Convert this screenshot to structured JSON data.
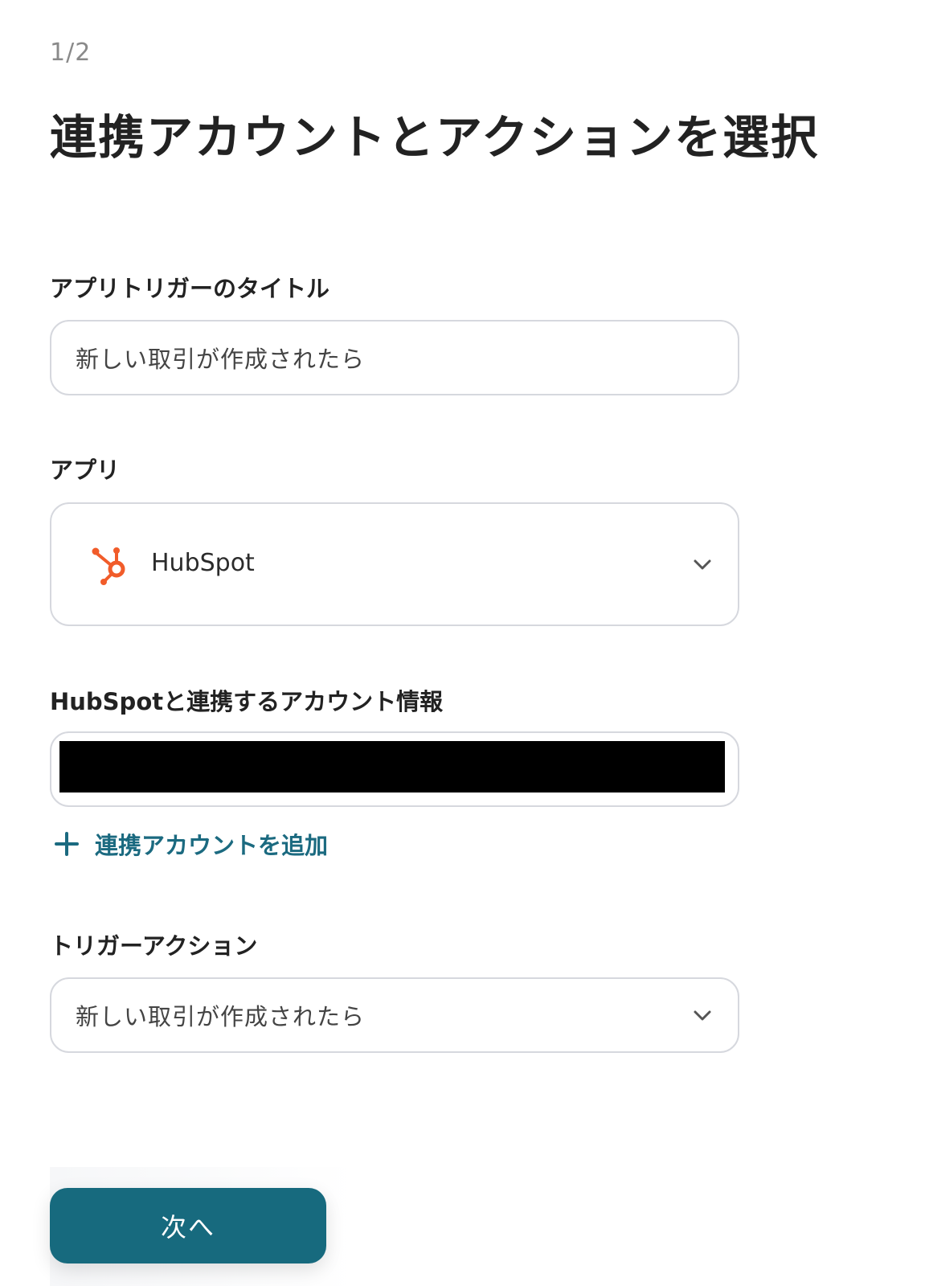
{
  "step": {
    "indicator": "1/2"
  },
  "page": {
    "title": "連携アカウントとアクションを選択"
  },
  "fields": {
    "trigger_title": {
      "label": "アプリトリガーのタイトル",
      "value": "新しい取引が作成されたら"
    },
    "app": {
      "label": "アプリ",
      "selected": "HubSpot",
      "icon": "hubspot-logo",
      "icon_color": "#f15c2a"
    },
    "account": {
      "label": "HubSpotと連携するアカウント情報",
      "value_redacted": true
    },
    "add_account": {
      "label": "連携アカウントを追加",
      "icon": "plus-icon"
    },
    "trigger_action": {
      "label": "トリガーアクション",
      "selected": "新しい取引が作成されたら"
    }
  },
  "footer": {
    "next_label": "次へ"
  },
  "colors": {
    "accent": "#176a7e",
    "link": "#1b6a80",
    "border": "#d6d8de",
    "hubspot": "#f15c2a"
  }
}
